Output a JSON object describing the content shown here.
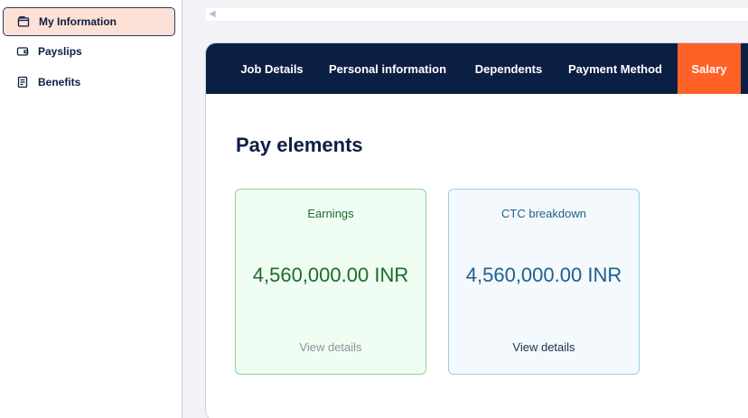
{
  "sidebar": {
    "items": [
      {
        "label": "My Information",
        "icon": "folder-icon",
        "active": true
      },
      {
        "label": "Payslips",
        "icon": "wallet-icon",
        "active": false
      },
      {
        "label": "Benefits",
        "icon": "document-list-icon",
        "active": false
      }
    ]
  },
  "tabs": [
    {
      "label": "Job Details",
      "active": false
    },
    {
      "label": "Personal information",
      "active": false
    },
    {
      "label": "Dependents",
      "active": false
    },
    {
      "label": "Payment Method",
      "active": false
    },
    {
      "label": "Salary",
      "active": true
    }
  ],
  "main": {
    "section_title": "Pay elements",
    "cards": [
      {
        "label": "Earnings",
        "amount": "4,560,000.00 INR",
        "link": "View details"
      },
      {
        "label": "CTC breakdown",
        "amount": "4,560,000.00 INR",
        "link": "View details"
      }
    ]
  },
  "colors": {
    "navy": "#0b1f44",
    "accent_orange": "#ff6126",
    "active_sidebar_bg": "#fde1d6",
    "earnings_green": "#1b6b2c",
    "ctc_blue": "#1d5f8c"
  }
}
